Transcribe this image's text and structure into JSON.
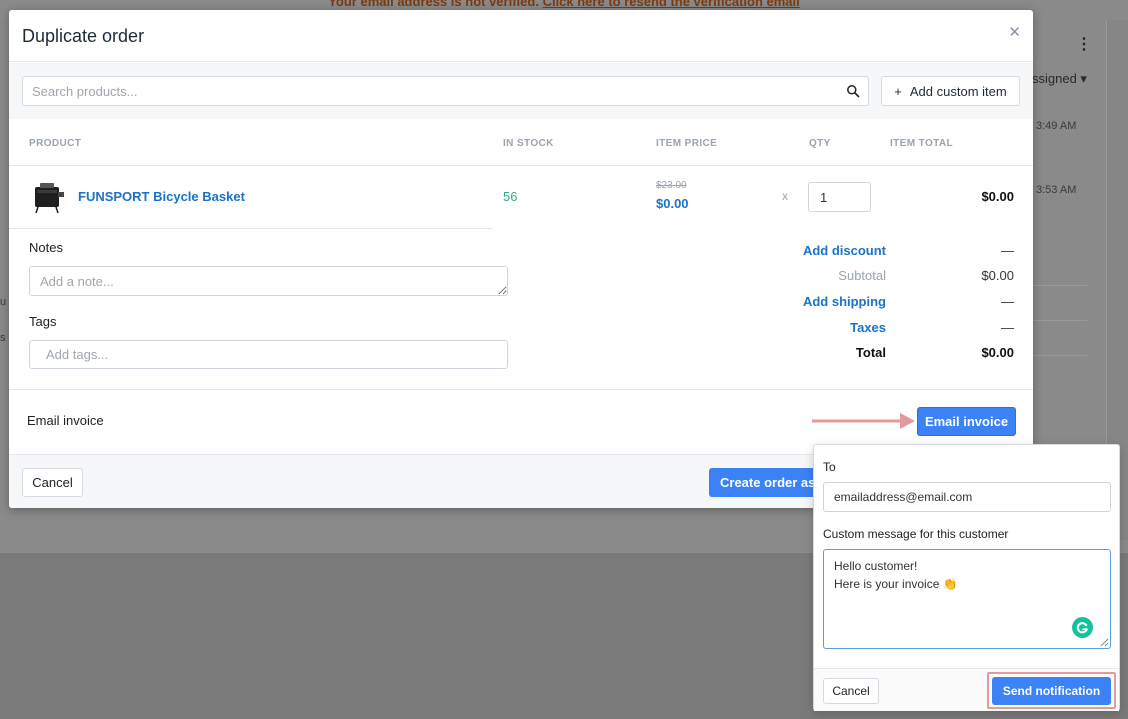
{
  "background": {
    "banner": {
      "text": "Your email address is not verified. ",
      "link": "Click here to resend the verification email"
    },
    "assigned_text": "ssigned",
    "times": [
      "3:49 AM",
      "3:53 AM"
    ]
  },
  "modal": {
    "title": "Duplicate order",
    "search": {
      "placeholder": "Search products..."
    },
    "add_custom_item": "Add custom item",
    "columns": {
      "product": "PRODUCT",
      "in_stock": "IN STOCK",
      "item_price": "ITEM PRICE",
      "qty": "QTY",
      "item_total": "ITEM TOTAL"
    },
    "line_item": {
      "name": "FUNSPORT Bicycle Basket",
      "in_stock": "56",
      "original_price": "$23.00",
      "price": "$0.00",
      "times": "x",
      "qty": "1",
      "total": "$0.00"
    },
    "notes": {
      "label": "Notes",
      "placeholder": "Add a note..."
    },
    "tags": {
      "label": "Tags",
      "placeholder": "Add tags..."
    },
    "summary": {
      "add_discount": "Add discount",
      "discount_value": "—",
      "subtotal_label": "Subtotal",
      "subtotal_value": "$0.00",
      "add_shipping": "Add shipping",
      "shipping_value": "—",
      "taxes_label": "Taxes",
      "taxes_value": "—",
      "total_label": "Total",
      "total_value": "$0.00"
    },
    "email_invoice_label": "Email invoice",
    "email_invoice_button": "Email invoice",
    "cancel": "Cancel",
    "create_order": "Create order as"
  },
  "popover": {
    "to_label": "To",
    "to_value": "emailaddress@email.com",
    "message_label": "Custom message for this customer",
    "message_line1": "Hello customer!",
    "message_line2": "Here is your invoice 👏",
    "cancel": "Cancel",
    "send": "Send notification"
  },
  "colors": {
    "accent": "#3b82f6",
    "link": "#1a73c9",
    "stock": "#29b179",
    "highlight": "#e39a9a"
  }
}
